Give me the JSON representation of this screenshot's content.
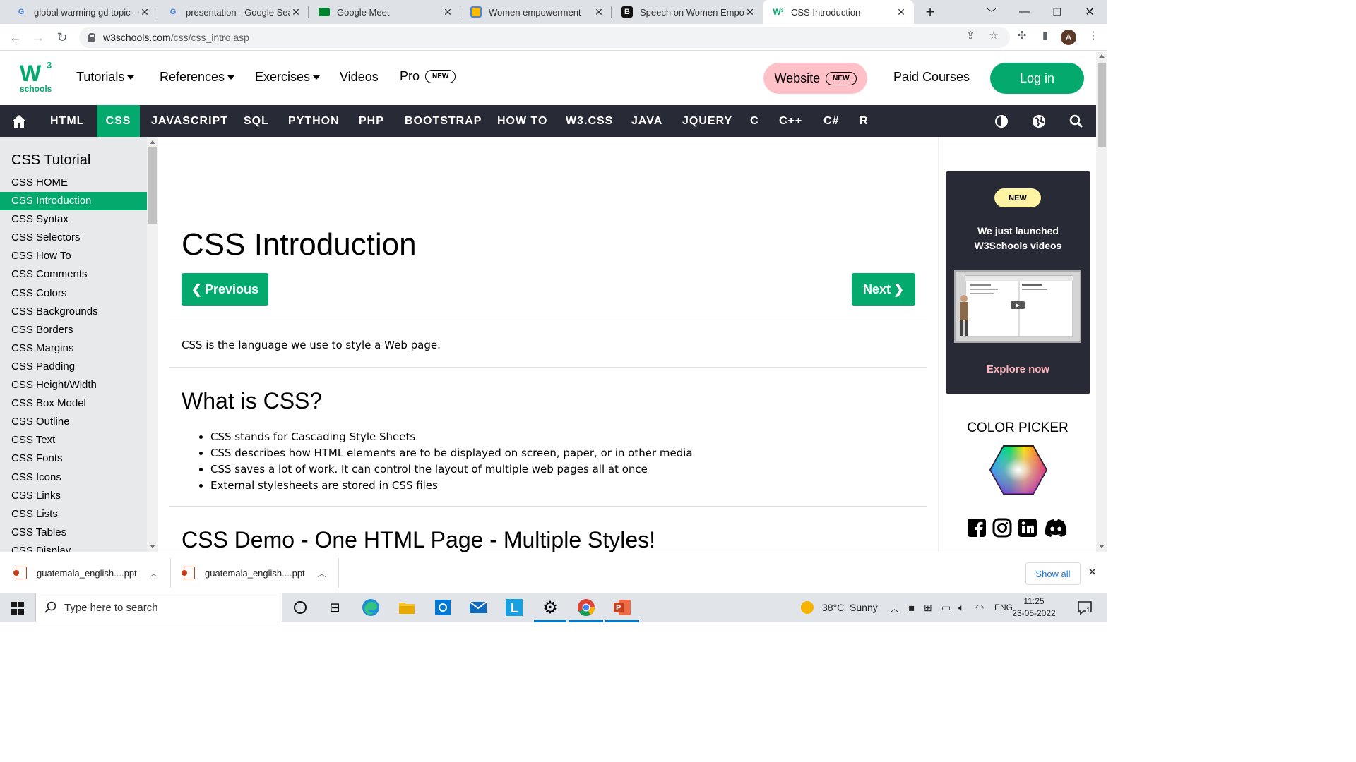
{
  "browser": {
    "tabs": [
      {
        "title": "global warming gd topic - G",
        "favicon": "google-icon",
        "active": false
      },
      {
        "title": "presentation - Google Sear",
        "favicon": "google-icon",
        "active": false
      },
      {
        "title": "Google Meet",
        "favicon": "google-meet-icon",
        "active": false
      },
      {
        "title": "Women empowerment",
        "favicon": "doc-icon",
        "active": false
      },
      {
        "title": "Speech on Women Empow",
        "favicon": "b-icon",
        "active": false
      },
      {
        "title": "CSS Introduction",
        "favicon": "w3schools-icon",
        "active": true
      }
    ],
    "url_host": "w3schools.com",
    "url_path": "/css/css_intro.asp",
    "profile_initial": "A"
  },
  "header": {
    "logo_text": "schools",
    "logo_sup": "3",
    "nav": [
      {
        "label": "Tutorials",
        "dropdown": true
      },
      {
        "label": "References",
        "dropdown": true
      },
      {
        "label": "Exercises",
        "dropdown": true
      },
      {
        "label": "Videos",
        "dropdown": false
      },
      {
        "label": "Pro",
        "badge": "NEW"
      }
    ],
    "website_label": "Website",
    "website_badge": "NEW",
    "paid_courses": "Paid Courses",
    "login": "Log in"
  },
  "topnav": {
    "items": [
      "HTML",
      "CSS",
      "JAVASCRIPT",
      "SQL",
      "PYTHON",
      "PHP",
      "BOOTSTRAP",
      "HOW TO",
      "W3.CSS",
      "JAVA",
      "JQUERY",
      "C",
      "C++",
      "C#",
      "R"
    ],
    "active": "CSS"
  },
  "sidebar": {
    "title": "CSS Tutorial",
    "items": [
      "CSS HOME",
      "CSS Introduction",
      "CSS Syntax",
      "CSS Selectors",
      "CSS How To",
      "CSS Comments",
      "CSS Colors",
      "CSS Backgrounds",
      "CSS Borders",
      "CSS Margins",
      "CSS Padding",
      "CSS Height/Width",
      "CSS Box Model",
      "CSS Outline",
      "CSS Text",
      "CSS Fonts",
      "CSS Icons",
      "CSS Links",
      "CSS Lists",
      "CSS Tables",
      "CSS Display"
    ],
    "active": "CSS Introduction"
  },
  "main": {
    "title": "CSS Introduction",
    "prev": "Previous",
    "next": "Next",
    "intro": "CSS is the language we use to style a Web page.",
    "h2_what": "What is CSS?",
    "bullets": [
      "CSS stands for Cascading Style Sheets",
      "CSS describes how HTML elements are to be displayed on screen, paper, or in other media",
      "CSS saves a lot of work. It can control the layout of multiple web pages all at once",
      "External stylesheets are stored in CSS files"
    ],
    "h2_demo": "CSS Demo - One HTML Page - Multiple Styles!"
  },
  "right": {
    "promo_badge": "NEW",
    "promo_line1": "We just launched",
    "promo_line2": "W3Schools videos",
    "promo_cta": "Explore now",
    "color_picker": "COLOR PICKER",
    "social": [
      "facebook-icon",
      "instagram-icon",
      "linkedin-icon",
      "discord-icon"
    ]
  },
  "downloads": {
    "items": [
      "guatemala_english....ppt",
      "guatemala_english....ppt"
    ],
    "show_all": "Show all"
  },
  "taskbar": {
    "search_placeholder": "Type here to search",
    "weather": "38°C  Sunny",
    "lang": "ENG",
    "time": "11:25",
    "date": "23-05-2022",
    "notifications": "1"
  },
  "colors": {
    "w3_green": "#04aa6d",
    "nav_dark": "#282a35",
    "sidebar_bg": "#e7e9eb",
    "website_pink": "#ffc0c7",
    "promo_yellow": "#fff4a3"
  }
}
